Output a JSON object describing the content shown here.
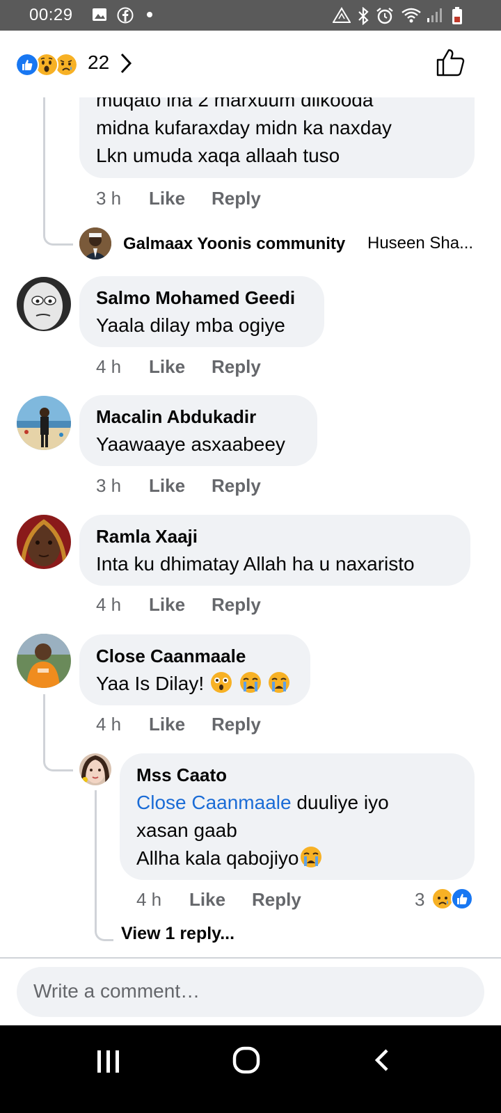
{
  "status_bar": {
    "time": "00:29"
  },
  "header": {
    "reaction_count": "22"
  },
  "comments": [
    {
      "lines": [
        "muqato ina 2 marxuum dilkooda",
        "midna kufaraxday midn ka naxday",
        " Lkn umuda xaqa allaah tuso"
      ],
      "time": "3 h",
      "like_label": "Like",
      "reply_label": "Reply"
    },
    {
      "reply_preview": {
        "author": "Galmaax Yoonis community",
        "snippet": "Huseen Sha..."
      }
    },
    {
      "author": "Salmo Mohamed Geedi",
      "text": "Yaala dilay mba ogiye",
      "time": "4 h",
      "like_label": "Like",
      "reply_label": "Reply"
    },
    {
      "author": "Macalin Abdukadir",
      "text": "Yaawaaye asxaabeey",
      "time": "3 h",
      "like_label": "Like",
      "reply_label": "Reply"
    },
    {
      "author": "Ramla Xaaji",
      "text": "Inta ku dhimatay Allah ha u naxaristo",
      "time": "4 h",
      "like_label": "Like",
      "reply_label": "Reply"
    },
    {
      "author": "Close Caanmaale",
      "text": "Yaa Is Dilay!",
      "time": "4 h",
      "like_label": "Like",
      "reply_label": "Reply"
    },
    {
      "author": "Mss Caato",
      "mention": "Close Caanmaale",
      "line1_rest": " duuliye iyo",
      "line2": "xasan gaab",
      "line3": "Allha kala qabojiyo",
      "time": "4 h",
      "like_label": "Like",
      "reply_label": "Reply",
      "reaction_count": "3"
    }
  ],
  "view_replies": "View 1 reply...",
  "composer": {
    "placeholder": "Write a comment…"
  },
  "colors": {
    "facebook_blue": "#1877f2",
    "bubble_bg": "#f0f2f5",
    "meta_gray": "#65676b",
    "link_blue": "#1b6cd6"
  }
}
